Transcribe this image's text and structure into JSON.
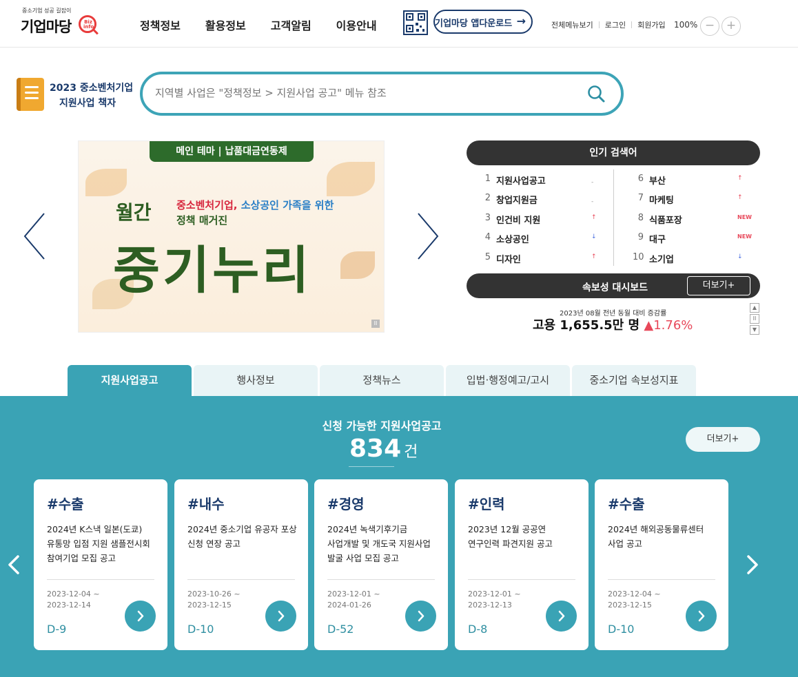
{
  "header": {
    "logo_tagline": "중소기업 성공 길잡이",
    "logo_text": "기업마당",
    "logo_mark": "Biz info",
    "nav": [
      "정책정보",
      "활용정보",
      "고객알림",
      "이용안내"
    ],
    "app_download": "기업마당 앱다운로드",
    "util_links": [
      "전체메뉴보기",
      "로그인",
      "회원가입"
    ],
    "zoom": "100%",
    "zoom_out": "−",
    "zoom_in": "+"
  },
  "book": {
    "line1": "2023 중소벤처기업",
    "line2": "지원사업 책자"
  },
  "search": {
    "placeholder": "지역별 사업은 \"정책정보 > 지원사업 공고\" 메뉴 참조"
  },
  "banner": {
    "tag": "메인 테마 | 납품대금연동제",
    "small": "월간",
    "sub_red": "중소벤처기업,",
    "sub_blue": "소상공인 가족을 위한",
    "sub2": "정책 매거진",
    "big": "중기누리",
    "pause": "II"
  },
  "popular": {
    "title": "인기 검색어",
    "left": [
      {
        "num": "1",
        "label": "지원사업공고",
        "trend": "-"
      },
      {
        "num": "2",
        "label": "창업지원금",
        "trend": "-"
      },
      {
        "num": "3",
        "label": "인건비 지원",
        "trend": "↑"
      },
      {
        "num": "4",
        "label": "소상공인",
        "trend": "↓"
      },
      {
        "num": "5",
        "label": "디자인",
        "trend": "↑"
      }
    ],
    "right": [
      {
        "num": "6",
        "label": "부산",
        "trend": "↑"
      },
      {
        "num": "7",
        "label": "마케팅",
        "trend": "↑"
      },
      {
        "num": "8",
        "label": "식품포장",
        "trend": "NEW"
      },
      {
        "num": "9",
        "label": "대구",
        "trend": "NEW"
      },
      {
        "num": "10",
        "label": "소기업",
        "trend": "↓"
      }
    ]
  },
  "dashboard": {
    "title": "속보성 대시보드",
    "more": "더보기+",
    "caption": "2023년 08월 전년 동월 대비 증감률",
    "value": "고용 1,655.5만 명",
    "change": "▲1.76%",
    "ctrl_up": "▲",
    "ctrl_pause": "II",
    "ctrl_down": "▼"
  },
  "tabs": [
    "지원사업공고",
    "행사정보",
    "정책뉴스",
    "입법·행정예고/고시",
    "중소기업 속보성지표"
  ],
  "section": {
    "title": "신청 가능한 지원사업공고",
    "count": "834",
    "count_unit": "건",
    "more": "더보기+"
  },
  "cards": [
    {
      "cat": "#수출",
      "title": "2024년 K스낵 일본(도쿄) 유통망 입점 지원 샘플전시회 참여기업 모집 공고",
      "start": "2023-12-04 ~",
      "end": "2023-12-14",
      "dday": "D-9"
    },
    {
      "cat": "#내수",
      "title": "2024년 중소기업 유공자 포상 신청 연장 공고",
      "start": "2023-10-26 ~",
      "end": "2023-12-15",
      "dday": "D-10"
    },
    {
      "cat": "#경영",
      "title": "2024년 녹색기후기금 사업개발 및 개도국 지원사업 발굴 사업 모집 공고",
      "start": "2023-12-01 ~",
      "end": "2024-01-26",
      "dday": "D-52"
    },
    {
      "cat": "#인력",
      "title": "2023년 12월 공공연 연구인력 파견지원 공고",
      "start": "2023-12-01 ~",
      "end": "2023-12-13",
      "dday": "D-8"
    },
    {
      "cat": "#수출",
      "title": "2024년 해외공동물류센터 사업 공고",
      "start": "2023-12-04 ~",
      "end": "2023-12-15",
      "dday": "D-10"
    }
  ],
  "colors": {
    "accent": "#3aa3b5",
    "navy": "#1a3a6b",
    "dark": "#333333",
    "up": "#e8485a",
    "down": "#4a6ee0"
  }
}
